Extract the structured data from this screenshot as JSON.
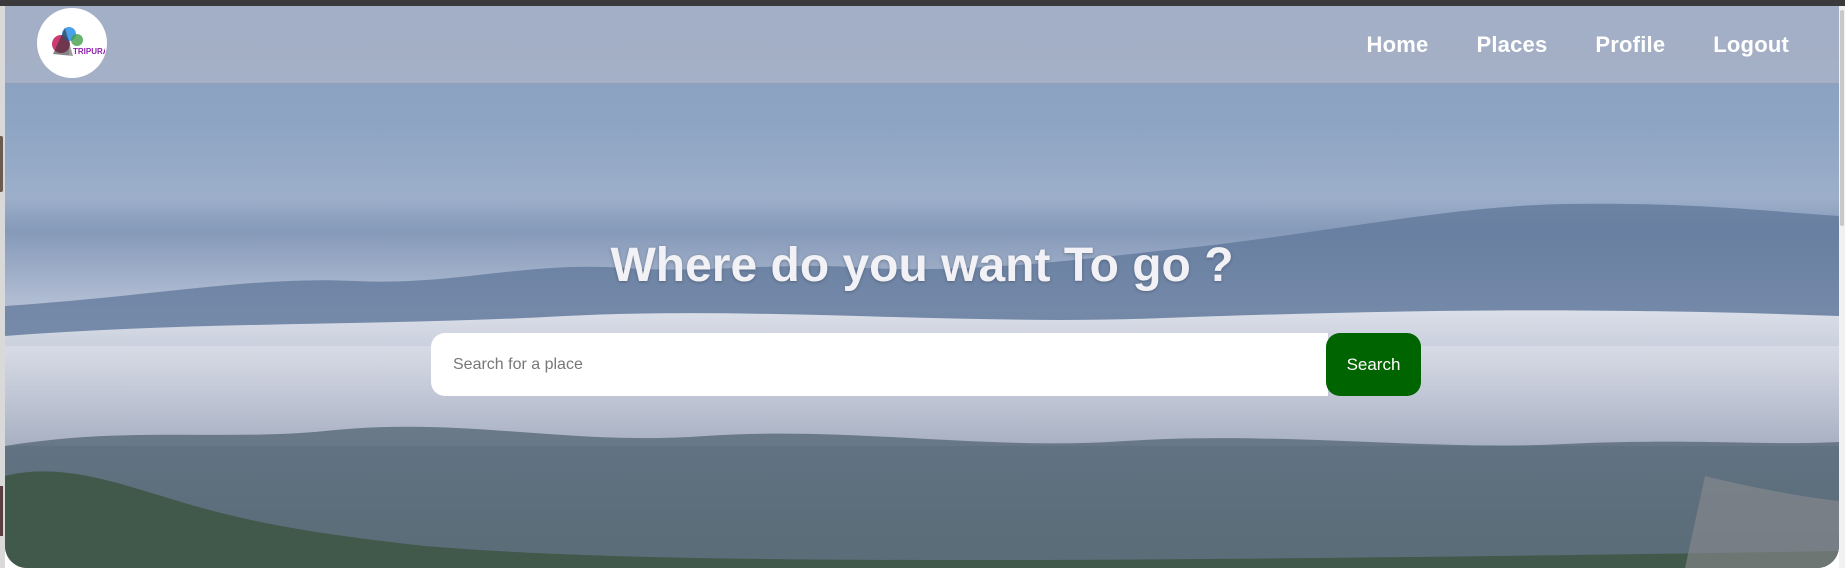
{
  "header": {
    "logo_text": "TRIPURA",
    "nav": [
      {
        "label": "Home"
      },
      {
        "label": "Places"
      },
      {
        "label": "Profile"
      },
      {
        "label": "Logout"
      }
    ]
  },
  "hero": {
    "title": "Where do you want To go ?",
    "search": {
      "placeholder": "Search for a place",
      "value": "",
      "button_label": "Search"
    }
  },
  "colors": {
    "search_button": "#006400",
    "nav_text": "#ffffff"
  }
}
